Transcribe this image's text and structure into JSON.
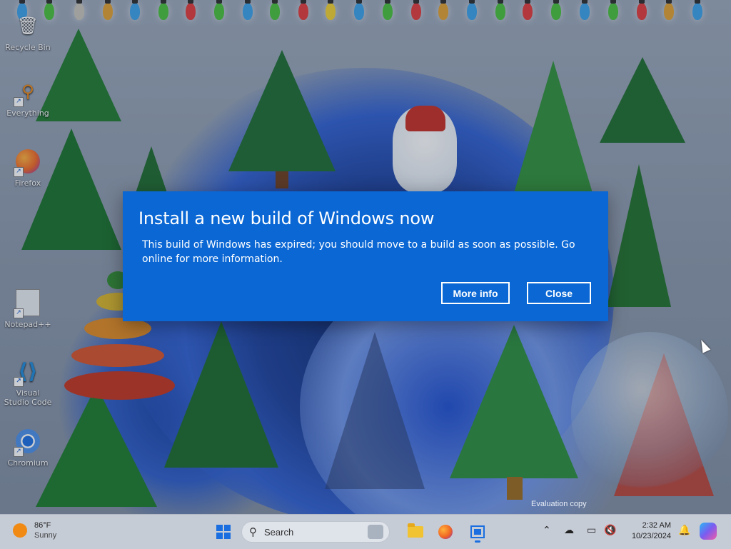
{
  "dialog": {
    "title": "Install a new build of Windows now",
    "message": "This build of Windows has expired; you should move to a build as soon as possible. Go online for more information.",
    "more_info_label": "More info",
    "close_label": "Close"
  },
  "desktop_icons": [
    {
      "label": "Recycle Bin",
      "icon": "recycle-bin-icon"
    },
    {
      "label": "Everything",
      "icon": "everything-search-icon"
    },
    {
      "label": "Firefox",
      "icon": "firefox-icon"
    },
    {
      "label": "Notepad++",
      "icon": "notepad-plus-plus-icon"
    },
    {
      "label": "Visual Studio Code",
      "icon": "vscode-icon"
    },
    {
      "label": "Chromium",
      "icon": "chromium-icon"
    }
  ],
  "watermark": "Evaluation copy",
  "taskbar": {
    "weather_temp": "86°F",
    "weather_cond": "Sunny",
    "search_placeholder": "Search",
    "time": "2:32 AM",
    "date": "10/23/2024"
  },
  "colors": {
    "dialog_bg": "#0a67d4",
    "taskbar_bg": "#c6ccd6",
    "accent": "#1a6ee0"
  }
}
